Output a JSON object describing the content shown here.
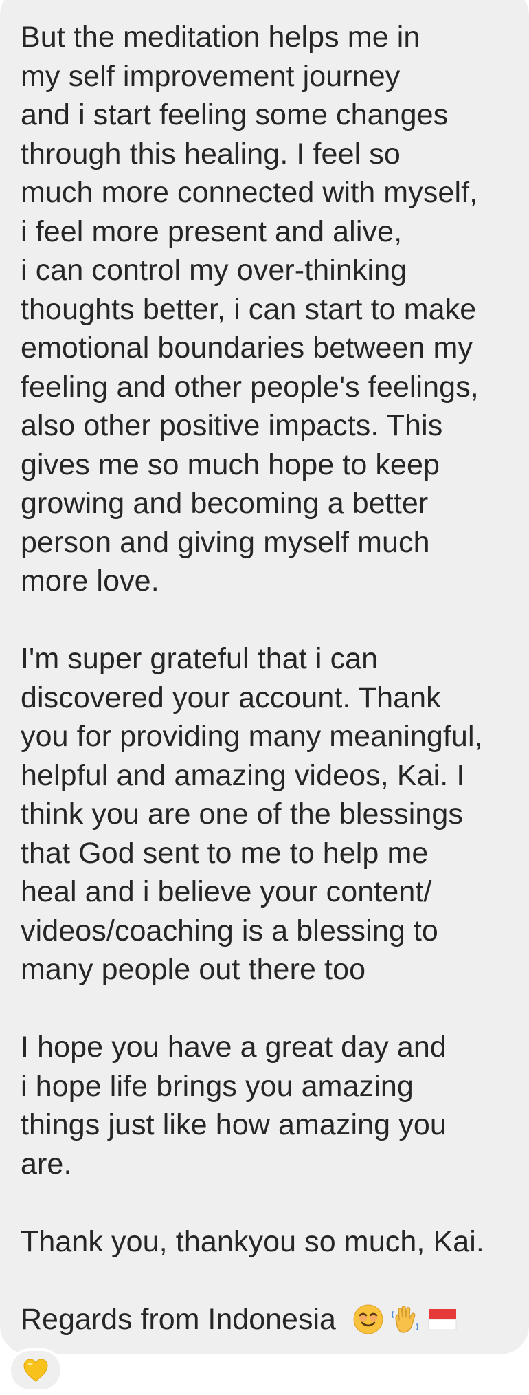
{
  "message": {
    "paragraph1": [
      "But the meditation helps me in",
      "my self improvement journey",
      "and i start feeling some changes",
      "through this healing. I feel so",
      "much more connected with myself,",
      "i feel more present and alive,",
      "i can control my over-thinking",
      "thoughts better, i can start to make",
      "emotional boundaries between my",
      "feeling and other people's feelings,",
      "also other positive impacts. This",
      "gives me so much hope to keep",
      "growing and becoming a better",
      "person and giving myself much",
      "more love."
    ],
    "paragraph2": [
      "I'm super grateful that i can",
      "discovered your account. Thank",
      "you for providing many meaningful,",
      "helpful and amazing videos, Kai. I",
      "think you are one of the blessings",
      "that God sent to me to help me",
      "heal and i believe your content/",
      "videos/coaching is a blessing to",
      "many people out there too"
    ],
    "paragraph3": [
      "I hope you have a great day and",
      "i hope life brings you amazing",
      "things just like how amazing you",
      "are."
    ],
    "paragraph4": [
      "Thank you, thankyou so much, Kai."
    ],
    "signoff_text": "Regards from Indonesia ",
    "signoff_emojis": [
      "smiling-face-icon",
      "waving-hand-icon",
      "indonesia-flag-icon"
    ]
  },
  "reaction": {
    "icon": "yellow-heart-icon",
    "color": "#f7c21b"
  },
  "colors": {
    "bubble_background": "#efefef",
    "text": "#262626",
    "page_background": "#ffffff"
  }
}
